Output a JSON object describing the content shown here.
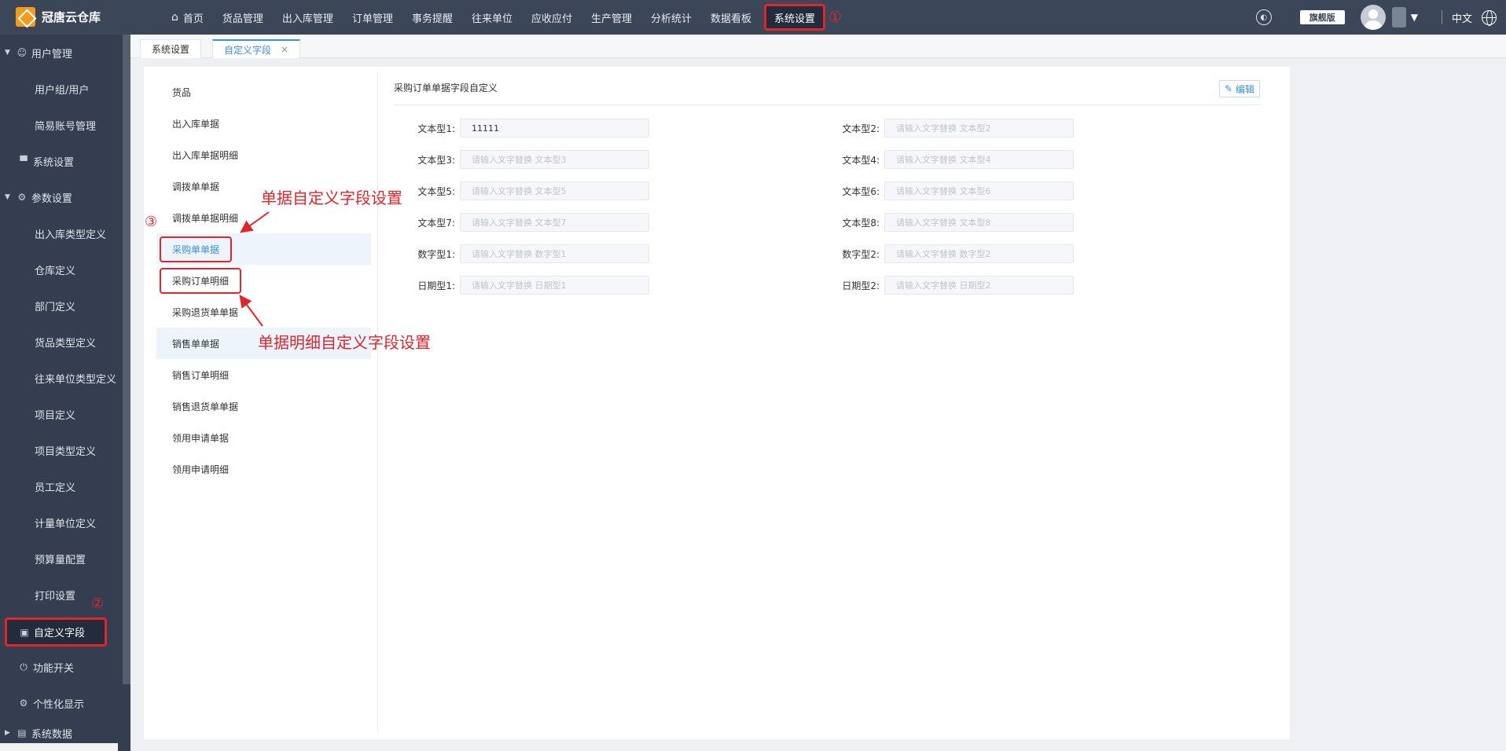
{
  "app": {
    "title": "冠唐云仓库",
    "edition_badge": "旗舰版",
    "language": "中文",
    "icons": {
      "logo": "logo-icon",
      "home": "home-icon",
      "helper": "helper-icon",
      "avatar": "avatar-icon",
      "globe": "globe-icon",
      "caret": "caret-down-icon"
    }
  },
  "topnav": {
    "items": [
      "首页",
      "货品管理",
      "出入库管理",
      "订单管理",
      "事务提醒",
      "往来单位",
      "应收应付",
      "生产管理",
      "分析统计",
      "数据看板",
      "系统设置"
    ],
    "active": "系统设置",
    "marker": "①"
  },
  "sidebar": {
    "items": [
      {
        "label": "用户管理",
        "level": 0,
        "arrow": "▼",
        "icon": "user-icon"
      },
      {
        "label": "用户组/用户",
        "level": 1
      },
      {
        "label": "简易账号管理",
        "level": 1
      },
      {
        "label": "系统设置",
        "level": 0,
        "icon": "monitor-icon"
      },
      {
        "label": "参数设置",
        "level": 0,
        "arrow": "▼",
        "icon": "gear-icon"
      },
      {
        "label": "出入库类型定义",
        "level": 1
      },
      {
        "label": "仓库定义",
        "level": 1
      },
      {
        "label": "部门定义",
        "level": 1
      },
      {
        "label": "货品类型定义",
        "level": 1
      },
      {
        "label": "往来单位类型定义",
        "level": 1
      },
      {
        "label": "项目定义",
        "level": 1
      },
      {
        "label": "项目类型定义",
        "level": 1
      },
      {
        "label": "员工定义",
        "level": 1
      },
      {
        "label": "计量单位定义",
        "level": 1
      },
      {
        "label": "预算量配置",
        "level": 1
      },
      {
        "label": "打印设置",
        "level": 1
      },
      {
        "label": "自定义字段",
        "level": 0,
        "icon": "form-icon",
        "selected": true
      },
      {
        "label": "功能开关",
        "level": 0,
        "icon": "power-icon"
      },
      {
        "label": "个性化显示",
        "level": 0,
        "icon": "gear-icon"
      },
      {
        "label": "系统数据",
        "level": 0,
        "arrow": "▶",
        "icon": "data-icon"
      }
    ],
    "marker": "②"
  },
  "tabs": [
    {
      "label": "系统设置",
      "active": false
    },
    {
      "label": "自定义字段",
      "active": true,
      "close": "×"
    }
  ],
  "doc_list": {
    "items": [
      "货品",
      "出入库单据",
      "出入库单据明细",
      "调拨单单据",
      "调拨单单据明细",
      "采购单单据",
      "采购订单明细",
      "采购退货单单据",
      "销售单单据",
      "销售订单明细",
      "销售退货单单据",
      "领用申请单据",
      "领用申请明细"
    ],
    "active": "采购单单据",
    "marker": "③"
  },
  "form": {
    "title": "采购订单单据字段自定义",
    "edit_label": "编辑",
    "fields": [
      {
        "label": "文本型1:",
        "value": "11111",
        "placeholder": ""
      },
      {
        "label": "文本型2:",
        "value": "",
        "placeholder": "请输入文字替换 文本型2"
      },
      {
        "label": "文本型3:",
        "value": "",
        "placeholder": "请输入文字替换 文本型3"
      },
      {
        "label": "文本型4:",
        "value": "",
        "placeholder": "请输入文字替换 文本型4"
      },
      {
        "label": "文本型5:",
        "value": "",
        "placeholder": "请输入文字替换 文本型5"
      },
      {
        "label": "文本型6:",
        "value": "",
        "placeholder": "请输入文字替换 文本型6"
      },
      {
        "label": "文本型7:",
        "value": "",
        "placeholder": "请输入文字替换 文本型7"
      },
      {
        "label": "文本型8:",
        "value": "",
        "placeholder": "请输入文字替换 文本型8"
      },
      {
        "label": "数字型1:",
        "value": "",
        "placeholder": "请输入文字替换 数字型1"
      },
      {
        "label": "数字型2:",
        "value": "",
        "placeholder": "请输入文字替换 数字型2"
      },
      {
        "label": "日期型1:",
        "value": "",
        "placeholder": "请输入文字替换 日期型1"
      },
      {
        "label": "日期型2:",
        "value": "",
        "placeholder": "请输入文字替换 日期型2"
      }
    ]
  },
  "annotations": {
    "header_note": "单据自定义字段设置",
    "detail_note": "单据明细自定义字段设置",
    "color": "#e0262b"
  },
  "colors": {
    "topbar": "#3b4659",
    "sidebar": "#343e50",
    "accent": "#3a8ee6",
    "highlight": "#e0262b"
  }
}
